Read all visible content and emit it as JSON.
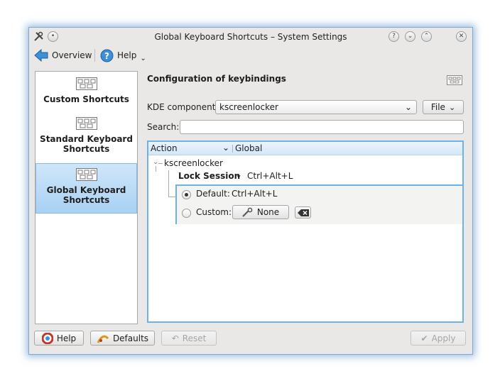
{
  "window": {
    "title": "Global Keyboard Shortcuts – System Settings"
  },
  "toolbar": {
    "overview": "Overview",
    "help": "Help"
  },
  "sidebar": {
    "items": [
      {
        "label": "Custom Shortcuts"
      },
      {
        "label": "Standard Keyboard Shortcuts"
      },
      {
        "label": "Global Keyboard Shortcuts",
        "selected": true
      }
    ]
  },
  "main": {
    "heading": "Configuration of keybindings",
    "component_label": "KDE component:",
    "component_value": "kscreenlocker",
    "file_button": "File",
    "search_label": "Search:",
    "search_value": "",
    "columns": [
      "Action",
      "Global"
    ],
    "tree": {
      "component": "kscreenlocker",
      "action": "Lock Session",
      "shortcut": "Ctrl+Alt+L",
      "default_label": "Default:",
      "default_value": "Ctrl+Alt+L",
      "custom_label": "Custom:",
      "custom_value": "None"
    }
  },
  "footer": {
    "help": "Help",
    "defaults": "Defaults",
    "reset": "Reset",
    "apply": "Apply"
  },
  "colors": {
    "selection": "#a8d1f3",
    "focus_border": "#6fb2e6",
    "glow": "#508cc8"
  }
}
